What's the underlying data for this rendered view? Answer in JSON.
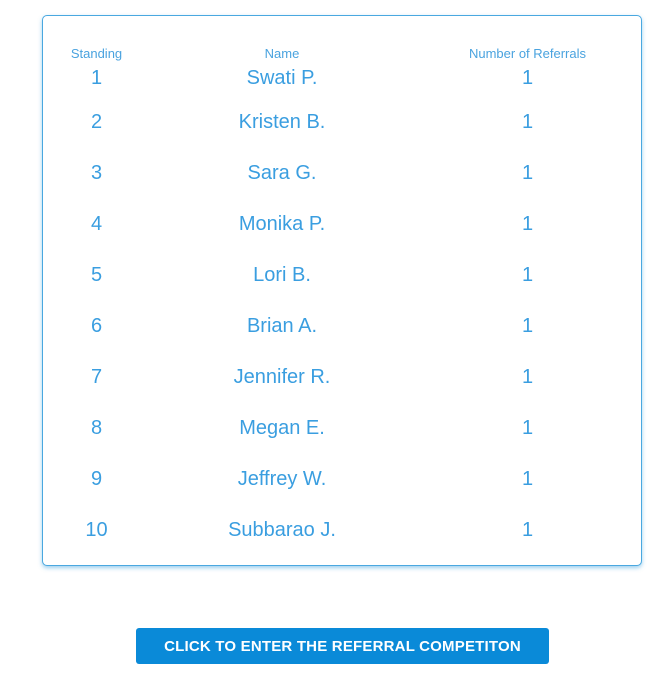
{
  "leaderboard": {
    "columns": {
      "standing": "Standing",
      "name": "Name",
      "referrals": "Number of Referrals"
    },
    "rows": [
      {
        "standing": "1",
        "name": "Swati P.",
        "referrals": "1"
      },
      {
        "standing": "2",
        "name": "Kristen B.",
        "referrals": "1"
      },
      {
        "standing": "3",
        "name": "Sara G.",
        "referrals": "1"
      },
      {
        "standing": "4",
        "name": "Monika P.",
        "referrals": "1"
      },
      {
        "standing": "5",
        "name": "Lori B.",
        "referrals": "1"
      },
      {
        "standing": "6",
        "name": "Brian A.",
        "referrals": "1"
      },
      {
        "standing": "7",
        "name": "Jennifer R.",
        "referrals": "1"
      },
      {
        "standing": "8",
        "name": "Megan E.",
        "referrals": "1"
      },
      {
        "standing": "9",
        "name": "Jeffrey W.",
        "referrals": "1"
      },
      {
        "standing": "10",
        "name": "Subbarao J.",
        "referrals": "1"
      }
    ]
  },
  "cta": {
    "label": "CLICK TO ENTER THE REFERRAL COMPETITON"
  },
  "colors": {
    "accent": "#3a9ee0",
    "button": "#0a8ad8",
    "border": "#4aa8e0"
  }
}
